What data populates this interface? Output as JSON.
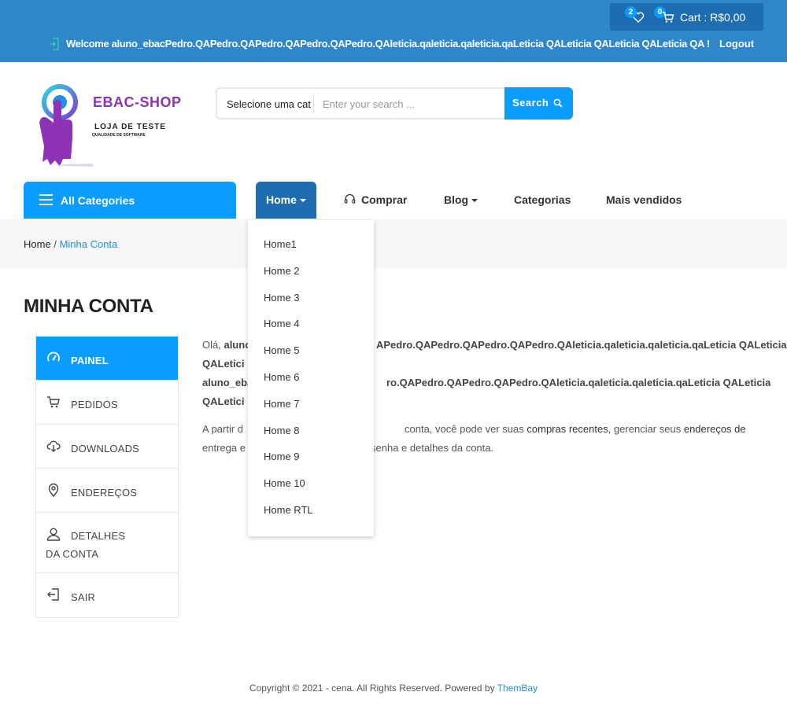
{
  "topbar": {
    "wishlist_count": "2",
    "cart_count": "0",
    "cart_label": "Cart : R$0,00",
    "welcome": "Welcome aluno_ebacPedro.QAPedro.QAPedro.QAPedro.QAPedro.QAleticia.qaleticia.qaleticia.qaLeticia QALeticia QALeticia QALeticia QA !",
    "logout": "Logout",
    "background": "#2f86c9"
  },
  "header": {
    "logo_title": "EBAC-SHOP",
    "logo_subtitle": "LOJA DE TESTE",
    "logo_tagline": "QUALIDADE DE SOFTWARE",
    "search": {
      "category": "Selecione uma cat",
      "placeholder": "Enter your search ...",
      "button": "Search"
    }
  },
  "nav": {
    "all_categories": "All Categories",
    "items": [
      {
        "label": "Home"
      },
      {
        "label": "Comprar"
      },
      {
        "label": "Blog"
      },
      {
        "label": "Categorias"
      },
      {
        "label": "Mais vendidos"
      }
    ],
    "home_dropdown": [
      "Home1",
      "Home 2",
      "Home 3",
      "Home 4",
      "Home 5",
      "Home 6",
      "Home 7",
      "Home 8",
      "Home 9",
      "Home 10",
      "Home RTL"
    ]
  },
  "breadcrumb": {
    "home": "Home",
    "separator": "/",
    "current": "Minha Conta"
  },
  "page_title": "MINHA CONTA",
  "account_menu": [
    {
      "label": "Painel",
      "icon": "dashboard-icon",
      "active": true
    },
    {
      "label": "Pedidos",
      "icon": "cart-icon"
    },
    {
      "label": "Downloads",
      "icon": "cloud-download-icon"
    },
    {
      "label": "Endereços",
      "icon": "location-pin-icon"
    },
    {
      "label": "Detalhes da conta",
      "icon": "user-icon"
    },
    {
      "label": "Sair",
      "icon": "logout-icon"
    }
  ],
  "dashboard": {
    "hello_prefix": "Olá,",
    "hello_visible_1": "aluno",
    "hello_visible_2": "APedro.QAPedro.QAPedro.QAPedro.QAleticia.qaleticia.qaleticia.qaLeticia QALeticia",
    "hello_visible_3": "QALetici",
    "hello_visible_4": "aluno_eba",
    "hello_visible_5": "ro.QAPedro.QAPedro.QAPedro.QAleticia.qaleticia.qaleticia.qaLeticia QALeticia",
    "hello_visible_6": "QALetici",
    "intro_start": "A partir d",
    "intro_mid": "conta, você pode ver suas",
    "link_orders": "compras recentes",
    "intro_and": ", gerenciar seus",
    "link_addresses": "endereços de",
    "intro_line2_start": "entrega e",
    "intro_line2_end": "senha e detalhes da conta."
  },
  "footer": {
    "text": "Copyright © 2021 - cena. All Rights Reserved. Powered by",
    "brand": "ThemBay"
  },
  "colors": {
    "accent": "#0a9cff",
    "dark_accent": "#1f6db1",
    "link": "#1f8fdc"
  }
}
